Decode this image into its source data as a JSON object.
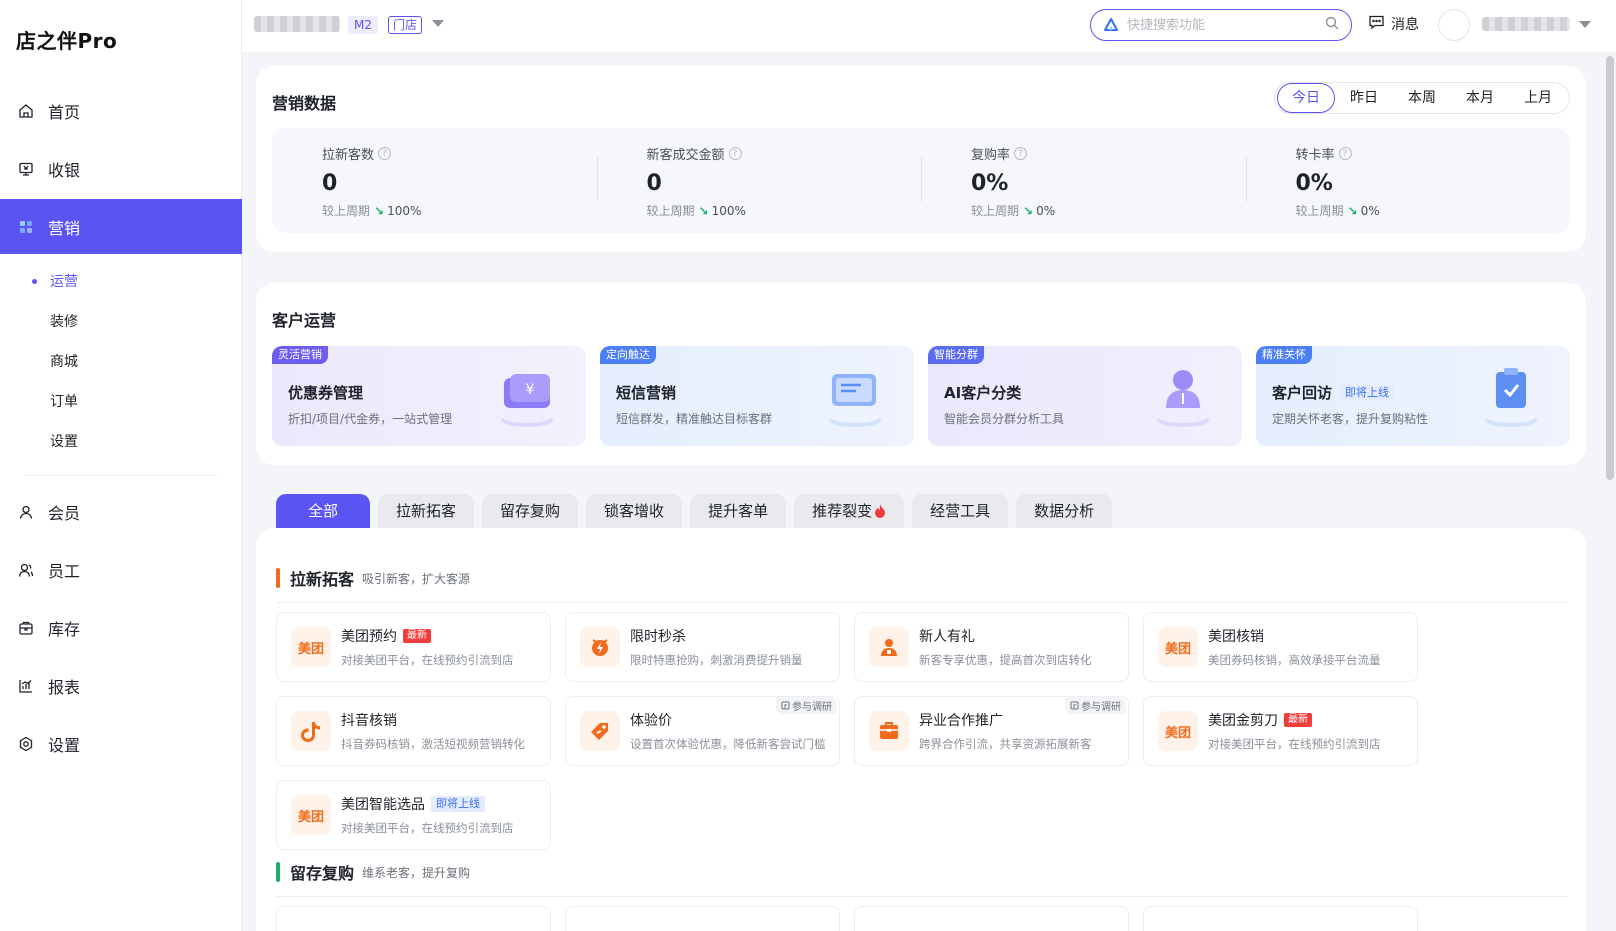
{
  "app": {
    "logo": "店之伴Pro"
  },
  "sidebar": {
    "items": [
      {
        "label": "首页",
        "icon": "home-icon"
      },
      {
        "label": "收银",
        "icon": "cashier-icon"
      },
      {
        "label": "营销",
        "icon": "marketing-icon",
        "active": true
      },
      {
        "label": "会员",
        "icon": "member-icon"
      },
      {
        "label": "员工",
        "icon": "staff-icon"
      },
      {
        "label": "库存",
        "icon": "inventory-icon"
      },
      {
        "label": "报表",
        "icon": "report-icon"
      },
      {
        "label": "设置",
        "icon": "settings-icon"
      }
    ],
    "subitems": [
      "运营",
      "装修",
      "商城",
      "订单",
      "设置"
    ]
  },
  "topbar": {
    "store_tag": "M2",
    "store_type": "门店",
    "search_placeholder": "快捷搜索功能",
    "messages": "消息"
  },
  "marketing_data": {
    "title": "营销数据",
    "periods": [
      "今日",
      "昨日",
      "本周",
      "本月",
      "上月"
    ],
    "active_period": "今日",
    "compare_label": "较上周期",
    "stats": [
      {
        "label": "拉新客数",
        "value": "0",
        "change": "100%"
      },
      {
        "label": "新客成交金额",
        "value": "0",
        "change": "100%"
      },
      {
        "label": "复购率",
        "value": "0%",
        "change": "0%"
      },
      {
        "label": "转卡率",
        "value": "0%",
        "change": "0%"
      }
    ]
  },
  "customer_ops": {
    "title": "客户运营",
    "cards": [
      {
        "badge": "灵活营销",
        "name": "优惠券管理",
        "desc": "折扣/项目/代金券，一站式管理",
        "badge_color": "#6e5cf0",
        "bg": "#eeeafc"
      },
      {
        "badge": "定向触达",
        "name": "短信营销",
        "desc": "短信群发，精准触达目标客群",
        "badge_color": "#4b7ff2",
        "bg": "#e8f0fd"
      },
      {
        "badge": "智能分群",
        "name": "AI客户分类",
        "desc": "智能会员分群分析工具",
        "badge_color": "#5b6cf0",
        "bg": "#ecebfb"
      },
      {
        "badge": "精准关怀",
        "name": "客户回访",
        "soon": "即将上线",
        "desc": "定期关怀老客，提升复购粘性",
        "badge_color": "#4b7ff2",
        "bg": "#e8f0fd"
      }
    ]
  },
  "tabs": [
    "全部",
    "拉新拓客",
    "留存复购",
    "锁客增收",
    "提升客单",
    "推荐裂变",
    "经营工具",
    "数据分析"
  ],
  "sections": [
    {
      "title": "拉新拓客",
      "subtitle": "吸引新客，扩大客源",
      "color": "#f26a1b",
      "tools": [
        {
          "name": "美团预约",
          "tag_new": "最新",
          "desc": "对接美团平台，在线预约引流到店",
          "icon": "meituan-icon",
          "icon_text": "美团"
        },
        {
          "name": "限时秒杀",
          "desc": "限时特惠抢购，刺激消费提升销量",
          "icon": "flash-sale-icon"
        },
        {
          "name": "新人有礼",
          "desc": "新客专享优惠，提高首次到店转化",
          "icon": "new-user-gift-icon"
        },
        {
          "name": "美团核销",
          "desc": "美团券码核销，高效承接平台流量",
          "icon": "meituan-icon",
          "icon_text": "美团"
        },
        {
          "name": "抖音核销",
          "desc": "抖音券码核销，激活短视频营销转化",
          "icon": "douyin-icon"
        },
        {
          "name": "体验价",
          "survey": "参与调研",
          "desc": "设置首次体验优惠，降低新客尝试门槛",
          "icon": "price-tag-icon"
        },
        {
          "name": "异业合作推广",
          "survey": "参与调研",
          "desc": "跨界合作引流，共享资源拓展新客",
          "icon": "partnership-icon"
        },
        {
          "name": "美团金剪刀",
          "tag_new": "最新",
          "desc": "对接美团平台，在线预约引流到店",
          "icon": "meituan-icon",
          "icon_text": "美团"
        },
        {
          "name": "美团智能选品",
          "soon": "即将上线",
          "desc": "对接美团平台，在线预约引流到店",
          "icon": "meituan-icon",
          "icon_text": "美团"
        }
      ]
    },
    {
      "title": "留存复购",
      "subtitle": "维系老客，提升复购",
      "color": "#1fae6e"
    }
  ]
}
